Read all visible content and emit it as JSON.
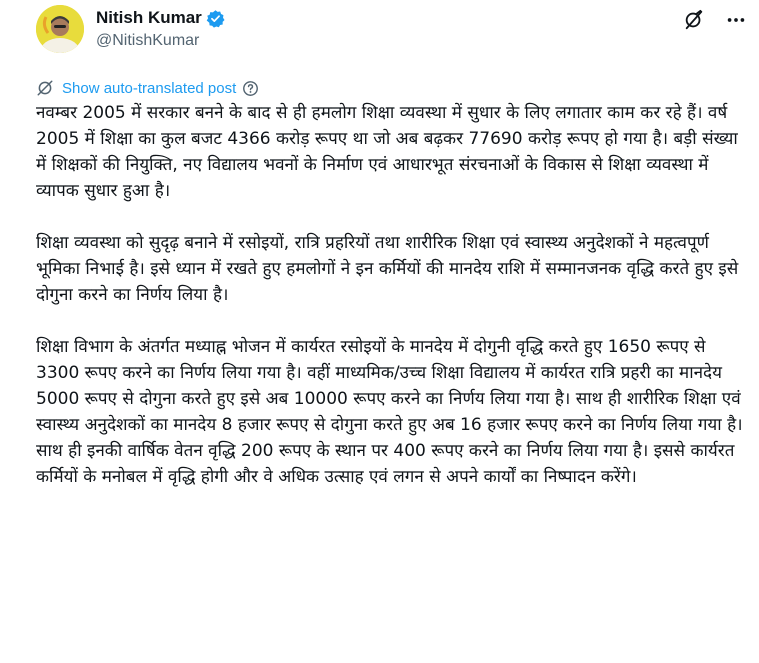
{
  "author": {
    "display_name": "Nitish Kumar",
    "handle": "@NitishKumar",
    "verified": true,
    "avatar_icon": "avatar-photo"
  },
  "header_actions": {
    "grok_icon": "grok-icon",
    "more_icon": "more-options-icon"
  },
  "translation": {
    "link_label": "Show auto-translated post",
    "icon": "translate-icon",
    "help_icon": "help-circle-icon"
  },
  "post": {
    "paragraphs": [
      "नवम्बर 2005 में सरकार बनने के बाद से ही हमलोग शिक्षा व्यवस्था में सुधार के लिए लगातार काम कर रहे हैं। वर्ष 2005 में शिक्षा का कुल बजट 4366 करोड़ रूपए था जो अब बढ़कर 77690 करोड़ रूपए हो गया है। बड़ी संख्या में शिक्षकों की नियुक्ति, नए विद्यालय भवनों के निर्माण एवं आधारभूत संरचनाओं के विकास से शिक्षा व्यवस्था में व्यापक सुधार हुआ है।",
      "शिक्षा व्यवस्था को सुदृढ़ बनाने में रसोइयों, रात्रि प्रहरियों तथा शारीरिक शिक्षा एवं स्वास्थ्य अनुदेशकों ने महत्वपूर्ण भूमिका निभाई है। इसे ध्यान में रखते हुए हमलोगों ने इन कर्मियों की मानदेय राशि में सम्मानजनक वृद्धि करते हुए इसे दोगुना करने का निर्णय लिया है।",
      "शिक्षा विभाग के अंतर्गत मध्याह्न भोजन में कार्यरत रसोइयों के मानदेय में दोगुनी वृद्धि करते हुए 1650 रूपए से 3300 रूपए करने का निर्णय लिया गया है। वहीं माध्यमिक/उच्च शिक्षा विद्यालय में कार्यरत रात्रि प्रहरी का मानदेय 5000 रूपए से दोगुना करते हुए इसे अब 10000 रूपए करने का निर्णय लिया गया है। साथ ही शारीरिक शिक्षा एवं स्वास्थ्य अनुदेशकों का मानदेय 8 हजार रूपए से दोगुना करते हुए अब 16 हजार रूपए करने का निर्णय लिया गया है। साथ ही इनकी वार्षिक वेतन वृद्धि 200 रूपए के स्थान पर 400 रूपए करने का निर्णय लिया गया है। इससे कार्यरत कर्मियों के मनोबल में वृद्धि होगी और वे अधिक उत्साह एवं लगन से अपने कार्यों का निष्पादन करेंगे।"
    ]
  },
  "colors": {
    "link": "#1d9bf0",
    "verified_badge": "#1d9bf0",
    "secondary_text": "#536471",
    "primary_text": "#0f1419"
  }
}
